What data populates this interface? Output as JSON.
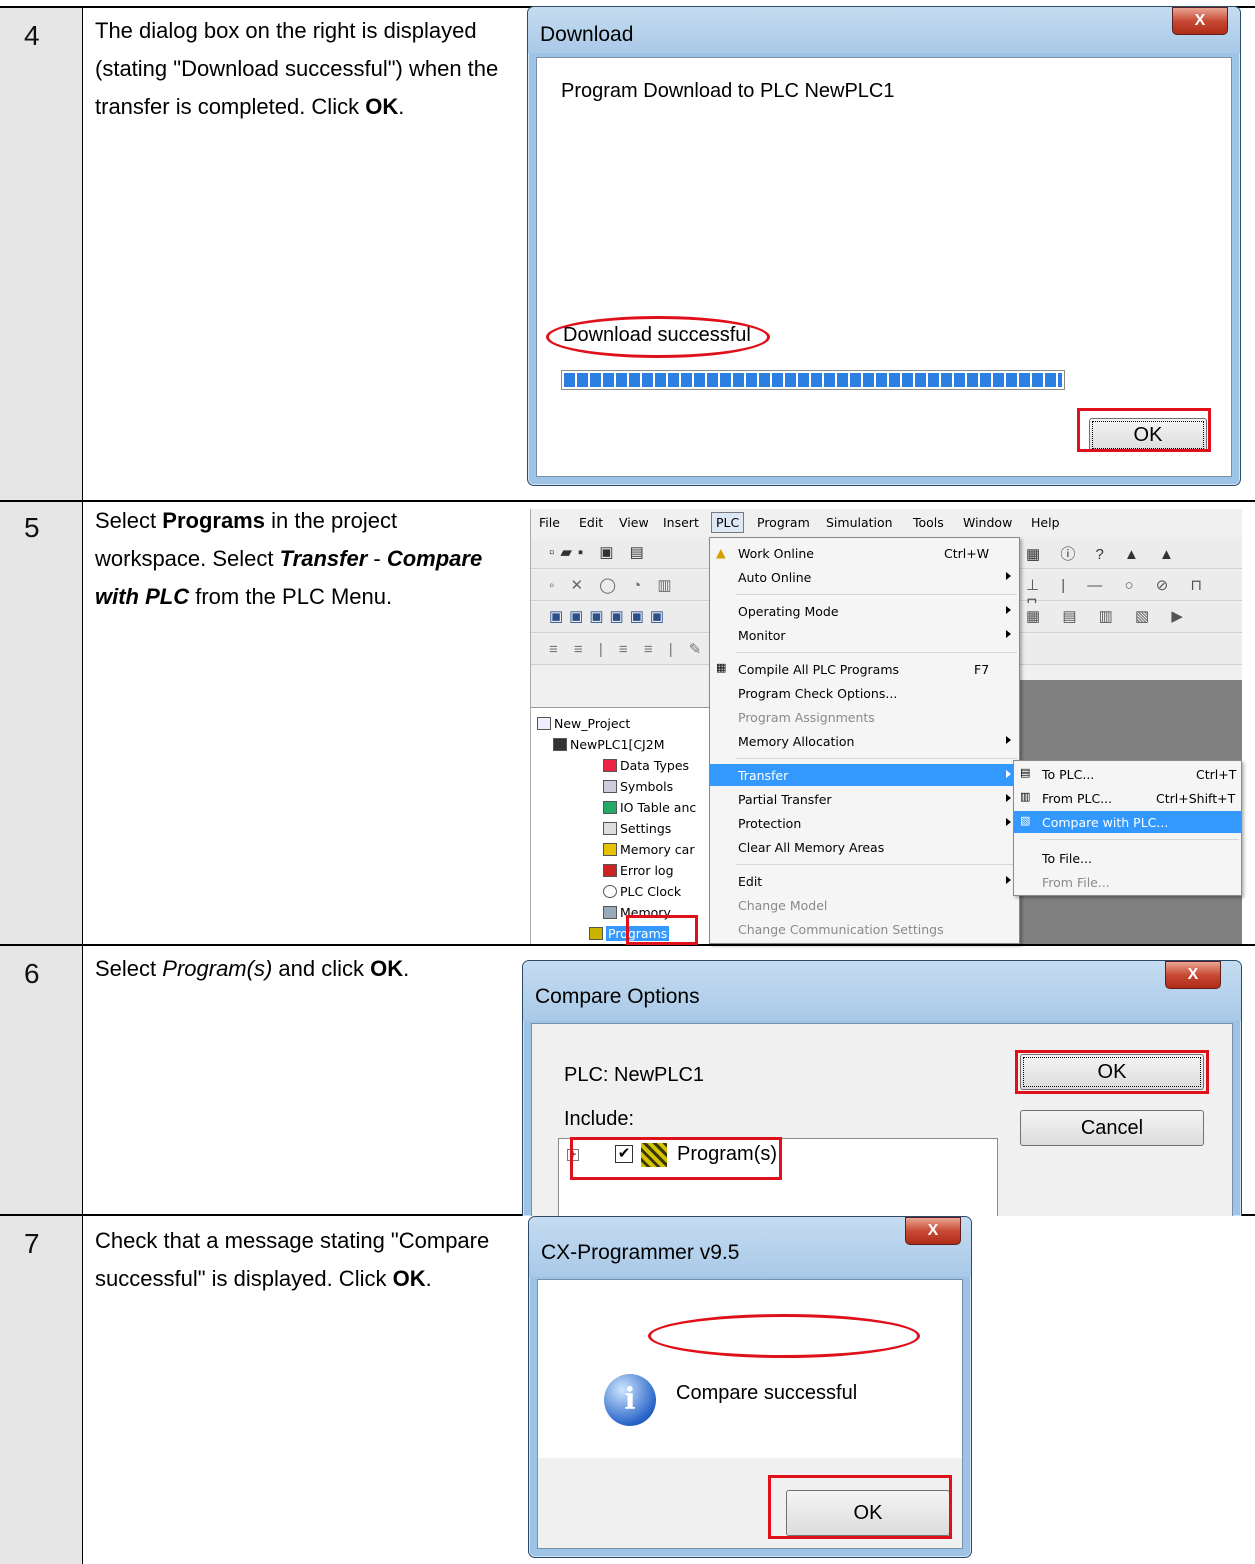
{
  "steps": [
    {
      "num": "4"
    },
    {
      "num": "5"
    },
    {
      "num": "6"
    },
    {
      "num": "7"
    }
  ],
  "step4": {
    "desc_a": "The dialog box on the right is displayed (stating \"Download successful\") when the transfer is completed. Click ",
    "desc_bold": "OK",
    "desc_end": ".",
    "dialog_title": "Download",
    "message": "Program Download to PLC NewPLC1",
    "status": "Download successful",
    "progress": 1.0,
    "ok_label": "OK",
    "close_label": "X"
  },
  "step5": {
    "desc_1": "Select ",
    "desc_2": "Programs",
    "desc_3": " in the project workspace. Select ",
    "desc_4": "Transfer",
    "desc_5": " - ",
    "desc_6": "Compare with PLC",
    "desc_7": " from the PLC Menu.",
    "menubar": [
      "File",
      "Edit",
      "View",
      "Insert",
      "PLC",
      "Program",
      "Simulation",
      "Tools",
      "Window",
      "Help"
    ],
    "plc_menu": [
      {
        "label": "Work Online",
        "shortcut": "Ctrl+W"
      },
      {
        "label": "Auto Online",
        "shortcut": ""
      },
      {
        "label": "Operating Mode",
        "shortcut": ""
      },
      {
        "label": "Monitor",
        "shortcut": ""
      },
      {
        "label": "Compile All PLC Programs",
        "shortcut": "F7"
      },
      {
        "label": "Program Check Options...",
        "shortcut": ""
      },
      {
        "label": "Program Assignments",
        "shortcut": ""
      },
      {
        "label": "Memory Allocation",
        "shortcut": ""
      },
      {
        "label": "Transfer",
        "shortcut": ""
      },
      {
        "label": "Partial Transfer",
        "shortcut": ""
      },
      {
        "label": "Protection",
        "shortcut": ""
      },
      {
        "label": "Clear All Memory Areas",
        "shortcut": ""
      },
      {
        "label": "Edit",
        "shortcut": ""
      },
      {
        "label": "Change Model",
        "shortcut": ""
      },
      {
        "label": "Change Communication Settings",
        "shortcut": ""
      }
    ],
    "transfer_menu": [
      {
        "label": "To PLC...",
        "shortcut": "Ctrl+T"
      },
      {
        "label": "From PLC...",
        "shortcut": "Ctrl+Shift+T"
      },
      {
        "label": "Compare with PLC...",
        "shortcut": ""
      },
      {
        "label": "To File...",
        "shortcut": ""
      },
      {
        "label": "From File...",
        "shortcut": ""
      }
    ],
    "tree": [
      "New_Project",
      "NewPLC1[CJ2M",
      "Data Types",
      "Symbols",
      "IO Table anc",
      "Settings",
      "Memory car",
      "Error log",
      "PLC Clock",
      "Memory",
      "Programs"
    ]
  },
  "step6": {
    "desc_1": "Select ",
    "desc_2": "Program(s)",
    "desc_3": " and click ",
    "desc_4": "OK",
    "desc_5": ".",
    "dialog_title": "Compare Options",
    "plc_label": "PLC:  NewPLC1",
    "include_label": "Include:",
    "program_item": "Program(s)",
    "ok_label": "OK",
    "cancel_label": "Cancel",
    "close_label": "X"
  },
  "step7": {
    "desc_a": "Check that a message stating \"Compare successful\" is displayed. Click ",
    "desc_bold": "OK",
    "desc_end": ".",
    "dialog_title": "CX-Programmer v9.5",
    "message": "Compare successful",
    "ok_label": "OK",
    "close_label": "X"
  }
}
